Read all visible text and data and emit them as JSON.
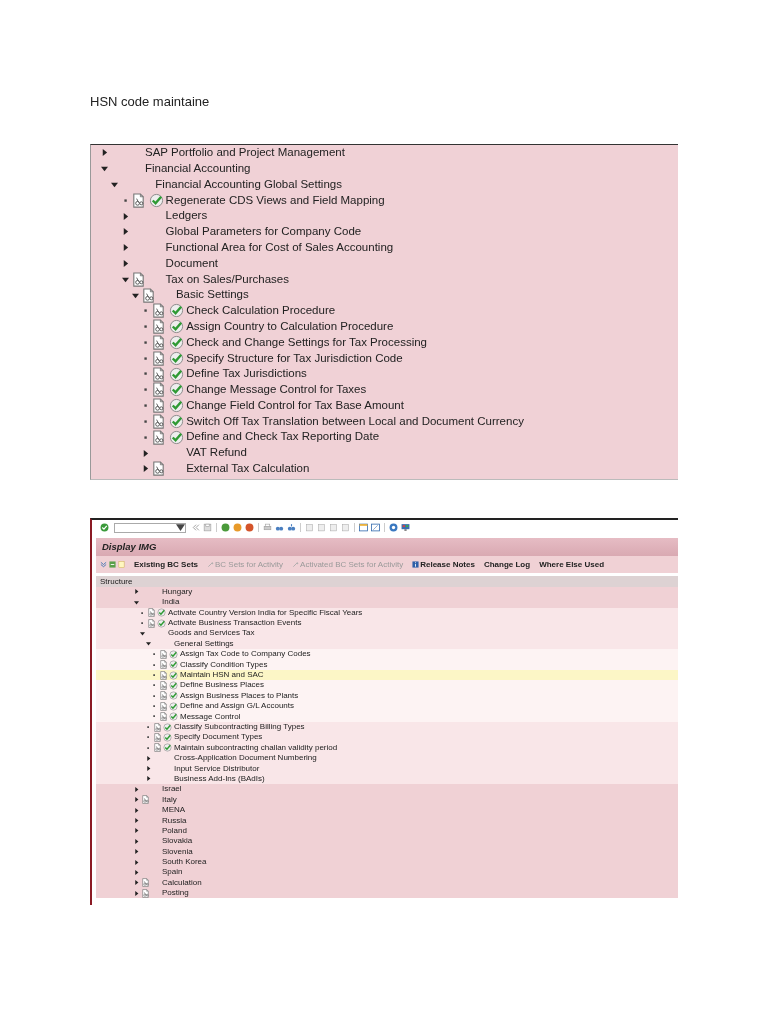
{
  "heading": "HSN code maintaine",
  "img_tree": {
    "items": [
      {
        "label": "SAP Portfolio and Project Management",
        "kind": "folder",
        "expanded": false
      },
      {
        "label": "Financial Accounting",
        "kind": "folder",
        "expanded": true,
        "children": [
          {
            "label": "Financial Accounting Global Settings",
            "kind": "folder",
            "expanded": true,
            "children": [
              {
                "label": "Regenerate CDS Views and Field Mapping",
                "kind": "activity"
              },
              {
                "label": "Ledgers",
                "kind": "folder",
                "expanded": false
              },
              {
                "label": "Global Parameters for Company Code",
                "kind": "folder",
                "expanded": false
              },
              {
                "label": "Functional Area for Cost of Sales Accounting",
                "kind": "folder",
                "expanded": false
              },
              {
                "label": "Document",
                "kind": "folder",
                "expanded": false
              },
              {
                "label": "Tax on Sales/Purchases",
                "kind": "doc-folder",
                "expanded": true,
                "children": [
                  {
                    "label": "Basic Settings",
                    "kind": "doc-folder",
                    "expanded": true,
                    "children": [
                      {
                        "label": "Check Calculation Procedure",
                        "kind": "activity"
                      },
                      {
                        "label": "Assign Country to Calculation Procedure",
                        "kind": "activity"
                      },
                      {
                        "label": "Check and Change Settings for Tax Processing",
                        "kind": "activity"
                      },
                      {
                        "label": "Specify Structure for Tax Jurisdiction Code",
                        "kind": "activity"
                      },
                      {
                        "label": "Define Tax Jurisdictions",
                        "kind": "activity"
                      },
                      {
                        "label": "Change Message Control for Taxes",
                        "kind": "activity"
                      },
                      {
                        "label": "Change Field Control for Tax Base Amount",
                        "kind": "activity"
                      },
                      {
                        "label": "Switch Off Tax Translation between Local and Document Currency",
                        "kind": "activity"
                      },
                      {
                        "label": "Define and Check Tax Reporting Date",
                        "kind": "activity"
                      },
                      {
                        "label": "VAT Refund",
                        "kind": "folder",
                        "expanded": false
                      },
                      {
                        "label": "External Tax Calculation",
                        "kind": "doc-folder",
                        "expanded": false
                      }
                    ]
                  }
                ]
              }
            ]
          }
        ]
      }
    ]
  },
  "display_img": {
    "title": "Display IMG",
    "app_toolbar": [
      {
        "label": "Existing BC Sets",
        "kind": "plain",
        "disabled": false
      },
      {
        "label": "BC Sets for Activity",
        "kind": "bc-set",
        "disabled": true
      },
      {
        "label": "Activated BC Sets for Activity",
        "kind": "bc-set",
        "disabled": true
      },
      {
        "label": "Release Notes",
        "kind": "info",
        "disabled": false
      },
      {
        "label": "Change Log",
        "kind": "plain",
        "disabled": false
      },
      {
        "label": "Where Else Used",
        "kind": "plain",
        "disabled": false
      }
    ],
    "structure_header": "Structure",
    "tree": [
      {
        "label": "Hungary",
        "kind": "folder",
        "expanded": false,
        "selected": false
      },
      {
        "label": "India",
        "kind": "folder",
        "expanded": true,
        "selected": false,
        "children": [
          {
            "label": "Activate Country Version India for Specific Fiscal Years",
            "kind": "activity",
            "selected": false
          },
          {
            "label": "Activate Business Transaction Events",
            "kind": "activity",
            "selected": false
          },
          {
            "label": "Goods and Services Tax",
            "kind": "folder",
            "expanded": true,
            "selected": false,
            "children": [
              {
                "label": "General Settings",
                "kind": "folder",
                "expanded": true,
                "selected": false,
                "children": [
                  {
                    "label": "Assign Tax Code to Company Codes",
                    "kind": "activity",
                    "selected": false
                  },
                  {
                    "label": "Classify Condition Types",
                    "kind": "activity",
                    "selected": false
                  },
                  {
                    "label": "Maintain HSN and SAC",
                    "kind": "activity",
                    "selected": true
                  },
                  {
                    "label": "Define Business Places",
                    "kind": "activity",
                    "selected": false
                  },
                  {
                    "label": "Assign Business Places to Plants",
                    "kind": "activity",
                    "selected": false
                  },
                  {
                    "label": "Define and Assign G/L Accounts",
                    "kind": "activity",
                    "selected": false
                  },
                  {
                    "label": "Message Control",
                    "kind": "activity",
                    "selected": false
                  }
                ]
              },
              {
                "label": "Classify Subcontracting Billing Types",
                "kind": "activity",
                "selected": false
              },
              {
                "label": "Specify Document Types",
                "kind": "activity",
                "selected": false
              },
              {
                "label": "Maintain subcontracting challan validity period",
                "kind": "activity",
                "selected": false
              },
              {
                "label": "Cross-Application Document Numbering",
                "kind": "folder",
                "expanded": false,
                "selected": false
              },
              {
                "label": "Input Service Distributor",
                "kind": "folder",
                "expanded": false,
                "selected": false
              },
              {
                "label": "Business Add-Ins (BAdIs)",
                "kind": "folder",
                "expanded": false,
                "selected": false
              }
            ]
          }
        ]
      },
      {
        "label": "Israel",
        "kind": "folder",
        "expanded": false,
        "selected": false
      },
      {
        "label": "Italy",
        "kind": "doc-folder",
        "expanded": false,
        "selected": false
      },
      {
        "label": "MENA",
        "kind": "folder",
        "expanded": false,
        "selected": false
      },
      {
        "label": "Russia",
        "kind": "folder",
        "expanded": false,
        "selected": false
      },
      {
        "label": "Poland",
        "kind": "folder",
        "expanded": false,
        "selected": false
      },
      {
        "label": "Slovakia",
        "kind": "folder",
        "expanded": false,
        "selected": false
      },
      {
        "label": "Slovenia",
        "kind": "folder",
        "expanded": false,
        "selected": false
      },
      {
        "label": "South Korea",
        "kind": "folder",
        "expanded": false,
        "selected": false
      },
      {
        "label": "Spain",
        "kind": "folder",
        "expanded": false,
        "selected": false
      },
      {
        "label": "Calculation",
        "kind": "doc-folder",
        "expanded": false,
        "selected": false
      },
      {
        "label": "Posting",
        "kind": "doc-folder",
        "expanded": false,
        "selected": false
      }
    ]
  }
}
